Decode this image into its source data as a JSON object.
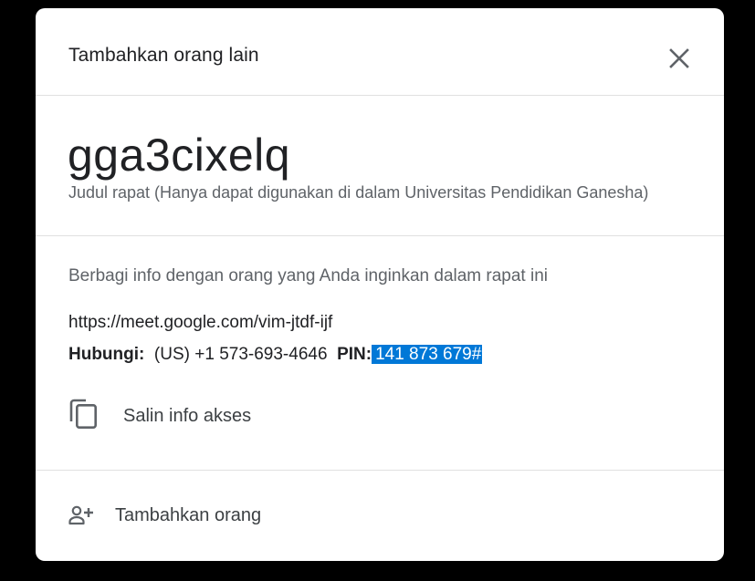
{
  "dialog": {
    "title": "Tambahkan orang lain",
    "close_icon": "close-icon"
  },
  "meeting": {
    "code": "gga3cixelq",
    "subtitle": "Judul rapat (Hanya dapat digunakan di dalam Universitas Pendidikan Ganesha)"
  },
  "info": {
    "share_text": "Berbagi info dengan orang yang Anda inginkan dalam rapat ini",
    "link": "https://meet.google.com/vim-jtdf-ijf",
    "phone_label": "Hubungi:",
    "phone_number": "(US) +1 573-693-4646",
    "pin_label": "PIN:",
    "pin_value": "141 873 679#",
    "copy_label": "Salin info akses",
    "copy_icon": "copy-icon"
  },
  "actions": {
    "add_people_label": "Tambahkan orang",
    "add_people_icon": "person-add-icon"
  },
  "colors": {
    "selection_highlight": "#0078d7",
    "primary_text": "#202124",
    "secondary_text": "#5f6368",
    "divider": "#e0e0e0"
  }
}
